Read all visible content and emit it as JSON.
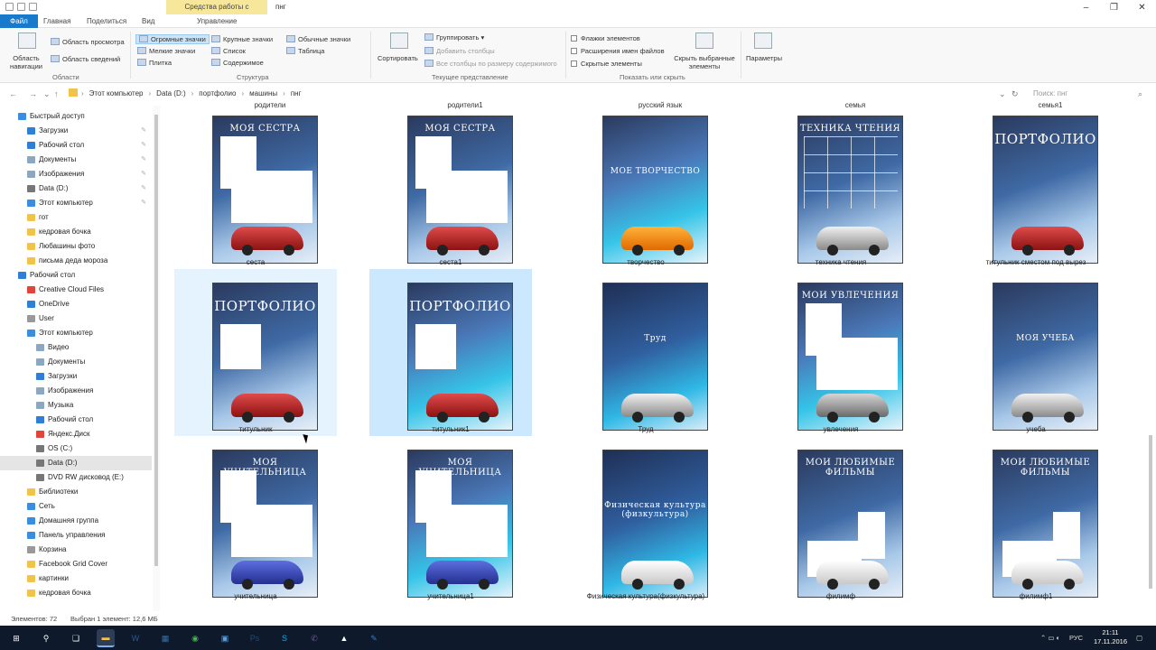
{
  "window": {
    "context_tab": "Средства работы с рисунками",
    "title": "пнг",
    "controls": [
      "–",
      "❐",
      "✕"
    ]
  },
  "ribbon_tabs": [
    "Файл",
    "Главная",
    "Поделиться",
    "Вид",
    "Управление"
  ],
  "ribbon": {
    "panels": {
      "nav_pane": "Область навигации",
      "preview": "Область просмотра",
      "details": "Область сведений",
      "group": "Области"
    },
    "layout": {
      "huge": "Огромные значки",
      "large": "Крупные значки",
      "normal": "Обычные значки",
      "small": "Мелкие значки",
      "list": "Список",
      "table": "Таблица",
      "tile": "Плитка",
      "content": "Содержимое",
      "group": "Структура"
    },
    "current_view": {
      "sort": "Сортировать",
      "group_by": "Группировать",
      "add_columns": "Добавить столбцы",
      "fit_columns": "Все столбцы по размеру содержимого",
      "group": "Текущее представление"
    },
    "show_hide": {
      "checkboxes": "Флажки элементов",
      "extensions": "Расширения имен файлов",
      "hidden": "Скрытые элементы",
      "hide_selected": "Скрыть выбранные элементы",
      "options": "Параметры",
      "group": "Показать или скрыть"
    }
  },
  "address": {
    "breadcrumbs": [
      "Этот компьютер",
      "Data (D:)",
      "портфолио",
      "машины",
      "пнг"
    ],
    "search_placeholder": "Поиск: пнг"
  },
  "sidebar": [
    {
      "label": "Быстрый доступ",
      "level": 0,
      "color": "#3b8de0"
    },
    {
      "label": "Загрузки",
      "level": 1,
      "color": "#2f7fd6",
      "pin": true
    },
    {
      "label": "Рабочий стол",
      "level": 1,
      "color": "#2f7fd6",
      "pin": true
    },
    {
      "label": "Документы",
      "level": 1,
      "color": "#8da6c2",
      "pin": true
    },
    {
      "label": "Изображения",
      "level": 1,
      "color": "#8da6c2",
      "pin": true
    },
    {
      "label": "Data (D:)",
      "level": 1,
      "color": "#777777",
      "pin": true
    },
    {
      "label": "Этот компьютер",
      "level": 1,
      "color": "#3b8de0",
      "pin": true
    },
    {
      "label": "гот",
      "level": 1,
      "color": "#f2c34a"
    },
    {
      "label": "кедровая бочка",
      "level": 1,
      "color": "#f2c34a"
    },
    {
      "label": "Любашины фото",
      "level": 1,
      "color": "#f2c34a"
    },
    {
      "label": "письма деда мороза",
      "level": 1,
      "color": "#f2c34a"
    },
    {
      "label": "Рабочий стол",
      "level": 0,
      "color": "#2f7fd6"
    },
    {
      "label": "Creative Cloud Files",
      "level": 1,
      "color": "#e0443a"
    },
    {
      "label": "OneDrive",
      "level": 1,
      "color": "#2f7fd6"
    },
    {
      "label": "User",
      "level": 1,
      "color": "#999999"
    },
    {
      "label": "Этот компьютер",
      "level": 1,
      "color": "#3b8de0"
    },
    {
      "label": "Видео",
      "level": 2,
      "color": "#8da6c2"
    },
    {
      "label": "Документы",
      "level": 2,
      "color": "#8da6c2"
    },
    {
      "label": "Загрузки",
      "level": 2,
      "color": "#2f7fd6"
    },
    {
      "label": "Изображения",
      "level": 2,
      "color": "#8da6c2"
    },
    {
      "label": "Музыка",
      "level": 2,
      "color": "#8da6c2"
    },
    {
      "label": "Рабочий стол",
      "level": 2,
      "color": "#2f7fd6"
    },
    {
      "label": "Яндекс.Диск",
      "level": 2,
      "color": "#e0443a"
    },
    {
      "label": "OS (C:)",
      "level": 2,
      "color": "#777777"
    },
    {
      "label": "Data (D:)",
      "level": 2,
      "color": "#777777",
      "selected": true
    },
    {
      "label": "DVD RW дисковод (E:)",
      "level": 2,
      "color": "#777777"
    },
    {
      "label": "Библиотеки",
      "level": 1,
      "color": "#f2c34a"
    },
    {
      "label": "Сеть",
      "level": 1,
      "color": "#3b8de0"
    },
    {
      "label": "Домашняя группа",
      "level": 1,
      "color": "#3b8de0"
    },
    {
      "label": "Панель управления",
      "level": 1,
      "color": "#3b8de0"
    },
    {
      "label": "Корзина",
      "level": 1,
      "color": "#999999"
    },
    {
      "label": "Facebook Grid Cover",
      "level": 1,
      "color": "#f2c34a"
    },
    {
      "label": "картинки",
      "level": 1,
      "color": "#f2c34a"
    },
    {
      "label": "кедровая бочка",
      "level": 1,
      "color": "#f2c34a"
    }
  ],
  "top_row_labels": [
    "родители",
    "родители1",
    "русский язык",
    "семья",
    "семья1"
  ],
  "files": [
    {
      "name": "сеста",
      "title": "МОЯ СЕСТРА",
      "style": "t1",
      "car": "red",
      "boxes": "two"
    },
    {
      "name": "сеста1",
      "title": "МОЯ СЕСТРА",
      "style": "t1",
      "car": "red",
      "boxes": "two"
    },
    {
      "name": "творчество",
      "title": "МОЕ ТВОРЧЕСТВО",
      "style": "t2",
      "car": "orange",
      "boxes": "none"
    },
    {
      "name": "техника чтения",
      "title": "ТЕХНИКА ЧТЕНИЯ",
      "style": "t1",
      "car": "silver",
      "boxes": "grid"
    },
    {
      "name": "титульник сместом под вырез",
      "title": "ПОРТФОЛИО",
      "style": "t1",
      "car": "red",
      "boxes": "none",
      "big": true
    },
    {
      "name": "титульник",
      "title": "ПОРТФОЛИО",
      "style": "t1",
      "car": "red",
      "boxes": "one",
      "big": true,
      "state": "hov"
    },
    {
      "name": "титульник1",
      "title": "ПОРТФОЛИО",
      "style": "t2",
      "car": "red",
      "boxes": "one",
      "big": true,
      "state": "sel"
    },
    {
      "name": "Труд",
      "title": "Труд",
      "style": "t3",
      "car": "silver",
      "boxes": "none"
    },
    {
      "name": "увлечения",
      "title": "МОИ УВЛЕЧЕНИЯ",
      "style": "t2",
      "car": "grey",
      "boxes": "two"
    },
    {
      "name": "учеба",
      "title": "МОЯ УЧЕБА",
      "style": "t1",
      "car": "silver",
      "boxes": "none"
    },
    {
      "name": "учительница",
      "title": "МОЯ УЧИТЕЛЬНИЦА",
      "style": "t1",
      "car": "blue",
      "boxes": "two"
    },
    {
      "name": "учительница1",
      "title": "МОЯ УЧИТЕЛЬНИЦА",
      "style": "t2",
      "car": "blue",
      "boxes": "two"
    },
    {
      "name": "Физическая культура(физкультура)",
      "title": "Физическая культура (физкультура)",
      "style": "t3",
      "car": "white",
      "boxes": "none"
    },
    {
      "name": "филимф",
      "title": "МОИ ЛЮБИМЫЕ ФИЛЬМЫ",
      "style": "t1",
      "car": "white",
      "boxes": "two-low"
    },
    {
      "name": "филимф1",
      "title": "МОИ ЛЮБИМЫЕ ФИЛЬМЫ",
      "style": "t1",
      "car": "white",
      "boxes": "two-low"
    }
  ],
  "status": {
    "count": "Элементов: 72",
    "selection": "Выбран 1 элемент: 12,6 МБ"
  },
  "taskbar": {
    "apps": [
      "start",
      "search",
      "task-view",
      "explorer",
      "word",
      "calculator",
      "chrome",
      "computer",
      "photoshop",
      "skype",
      "viber",
      "photos",
      "other"
    ],
    "lang": "РУС",
    "time": "21:11",
    "date": "17.11.2016"
  }
}
